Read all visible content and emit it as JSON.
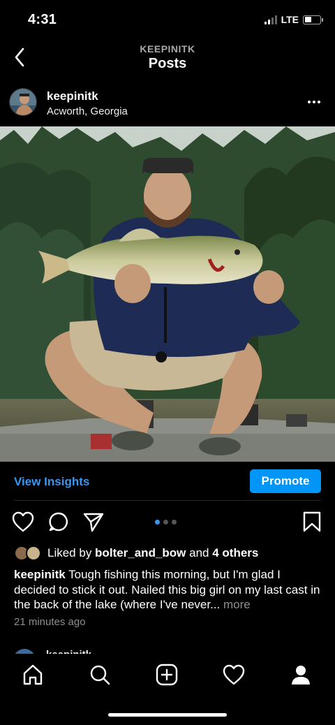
{
  "status_bar": {
    "time": "4:31",
    "network": "LTE",
    "signal_bars": 2,
    "battery_level": 0.45
  },
  "nav": {
    "subtitle": "KEEPINITK",
    "title": "Posts"
  },
  "post": {
    "username": "keepinitk",
    "location": "Acworth, Georgia",
    "photo_description_icon": "photo-man-holding-bass",
    "insights_label": "View Insights",
    "promote_label": "Promote",
    "carousel": {
      "count": 3,
      "active": 1
    },
    "likes": {
      "prefix": "Liked by ",
      "user": "bolter_and_bow",
      "middle": " and ",
      "others": "4 others"
    },
    "caption": {
      "user": "keepinitk",
      "text": " Tough fishing this morning, but I'm glad I decided to stick it out. Nailed this big girl on my last cast in the back of the lake (where I've never...",
      "more": " more"
    },
    "time_ago": "21 minutes ago"
  },
  "next_post": {
    "username": "keepinitk"
  },
  "colors": {
    "accent": "#3897f0",
    "promote": "#0095f6",
    "muted": "#8e8e8e",
    "background": "#000000"
  },
  "icons": {
    "back": "chevron-left-icon",
    "more": "more-icon",
    "like": "heart-icon",
    "comment": "comment-icon",
    "share": "send-icon",
    "save": "bookmark-icon",
    "home": "home-icon",
    "search": "search-icon",
    "add": "add-post-icon",
    "activity": "heart-icon",
    "profile": "profile-icon"
  }
}
